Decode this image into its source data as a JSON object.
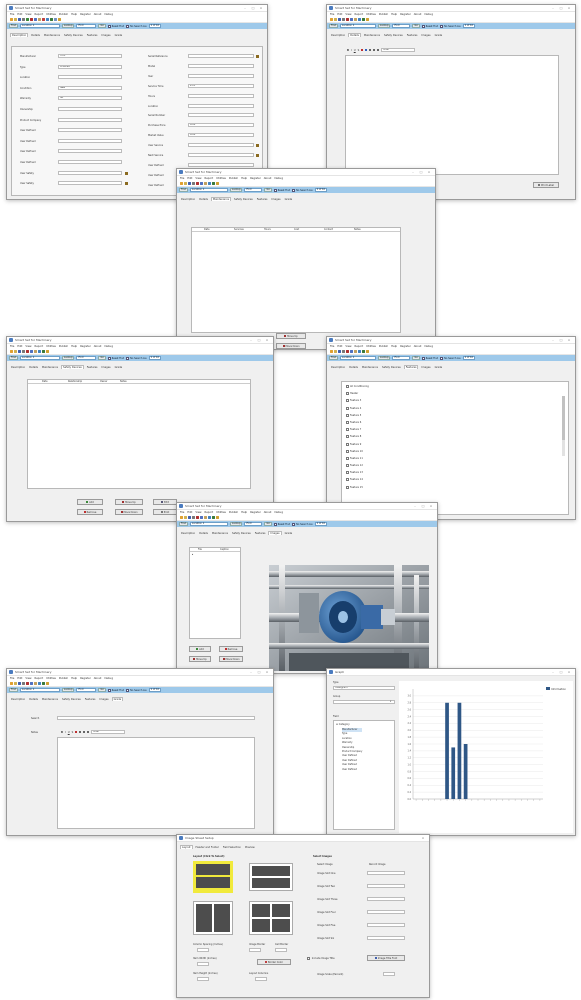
{
  "app": {
    "title": "Smart Set for Machinery",
    "menu": [
      "File",
      "Edit",
      "View",
      "Report",
      "Utilities",
      "Publish",
      "Help",
      "Register",
      "About",
      "Debug"
    ],
    "search": {
      "value": "Location 1",
      "lookup": "Lookup",
      "find": "Find",
      "go": "Go",
      "reset": "Reset Find",
      "no_search": "No Search Lie",
      "count": "1 of 10"
    },
    "tabs": [
      "Description",
      "Details",
      "Maintenance",
      "Safety Devices",
      "Features",
      "Images",
      "Grade"
    ]
  },
  "desc_form": {
    "left_labels": [
      "Manufacturer",
      "Type",
      "Location",
      "Condition",
      "Warranty",
      "Ownership",
      "Product Company",
      "User Defined",
      "User Defined",
      "User Defined",
      "User Defined",
      "User Safety",
      "User Safety"
    ],
    "left_values": [
      "Ford",
      "Crushed",
      "",
      "New",
      "No",
      "",
      "",
      "",
      "",
      "",
      "",
      "",
      ""
    ],
    "right_labels": [
      "Serial Reference",
      "Model",
      "Year",
      "Service Time",
      "Hours",
      "Location",
      "Serial Number",
      "Purchase Price",
      "Market Value",
      "User Service",
      "Next Service",
      "User Defined",
      "User Defined",
      "User Defined"
    ],
    "right_values": [
      "",
      "",
      "",
      "2.25",
      "",
      "",
      "",
      "0.00",
      "0.00",
      "",
      "",
      "",
      "",
      ""
    ]
  },
  "details": {
    "print_label": "Print Label",
    "font_label": "Arial"
  },
  "maintenance": {
    "columns": [
      "Date",
      "Services",
      "Hours",
      "Cost",
      "Contact",
      "Notes"
    ],
    "buttons": [
      "Move Up",
      "Move Down"
    ]
  },
  "safety": {
    "columns": [
      "Date",
      "Relationship",
      "Owner",
      "Notes"
    ],
    "buttons": [
      "Add",
      "Remove",
      "Move Up",
      "Move Down",
      "Edit",
      "Print"
    ]
  },
  "features": {
    "items": [
      "All Conditioning",
      "Heater",
      "Feature 3",
      "Feature 4",
      "Feature 5",
      "Feature 6",
      "Feature 7",
      "Feature 8",
      "Feature 9",
      "Feature 10",
      "Feature 11",
      "Feature 12",
      "Feature 13",
      "Feature 14",
      "Feature 15"
    ]
  },
  "images": {
    "columns": [
      "File",
      "Caption"
    ],
    "buttons": [
      "Add",
      "Remove",
      "Move Up",
      "Move Down"
    ]
  },
  "notes": {
    "label1": "Search",
    "label2": "Notes",
    "font_label": "Arial"
  },
  "graph": {
    "title": "Graph",
    "legend": "Information",
    "type_label": "Type",
    "type_value": "Histogram",
    "group_label": "Group",
    "field_label": "Field",
    "tree_root": "Category",
    "tree_items": [
      "Manufacturer",
      "Type",
      "Location",
      "Warranty",
      "Ownership",
      "Product Company",
      "User Defined",
      "User Defined",
      "User Defined",
      "User Defined"
    ]
  },
  "chart_data": {
    "type": "bar",
    "categories": [
      "",
      "",
      "",
      "",
      "",
      "",
      "",
      "",
      "",
      "",
      "",
      "",
      "",
      "",
      "",
      "",
      "",
      "",
      "",
      "",
      ""
    ],
    "values": [
      0,
      0,
      0,
      0,
      0,
      2.8,
      1.5,
      2.8,
      1.6,
      0,
      0,
      0,
      0,
      0,
      0,
      0,
      0,
      0,
      0,
      0,
      0
    ],
    "ylim": [
      0,
      3.2
    ],
    "yticks": [
      "3.0",
      "2.8",
      "2.6",
      "2.4",
      "2.2",
      "2.0",
      "1.8",
      "1.6",
      "1.4",
      "1.2",
      "1.0",
      "0.8",
      "0.6",
      "0.4",
      "0.2",
      "0.0"
    ],
    "grid": true,
    "legend": "top-right",
    "color": "#2f5786"
  },
  "layout_dialog": {
    "title": "Image Sheet Setup",
    "tabs": [
      "Layout",
      "Header and Footer",
      "Field Selection",
      "Preview"
    ],
    "heading": "Layout (Click To Select)",
    "select_heading": "Select Images",
    "col_heading1": "Select Image",
    "col_heading2": "Record Image",
    "rows": [
      "Image Slot One",
      "Image Slot Two",
      "Image Slot Three",
      "Image Slot Four",
      "Image Slot Five",
      "Image Slot Six"
    ],
    "spacing_label": "Column Spacing (Inches)",
    "border_label": "Image Border",
    "cell_label": "Cell Border",
    "width_label": "Item Width (Inches)",
    "height_label": "Item Height (Inches)",
    "layout_label": "Layout Columns",
    "border_color": "Border Color",
    "include_label": "Include Image Title",
    "title_font": "Image Title Font",
    "scale_label": "Image Scale (Percent)"
  },
  "colors": {
    "accent": "#9ec9ea",
    "bar": "#2f5786",
    "highlight": "#f1ea3c"
  }
}
